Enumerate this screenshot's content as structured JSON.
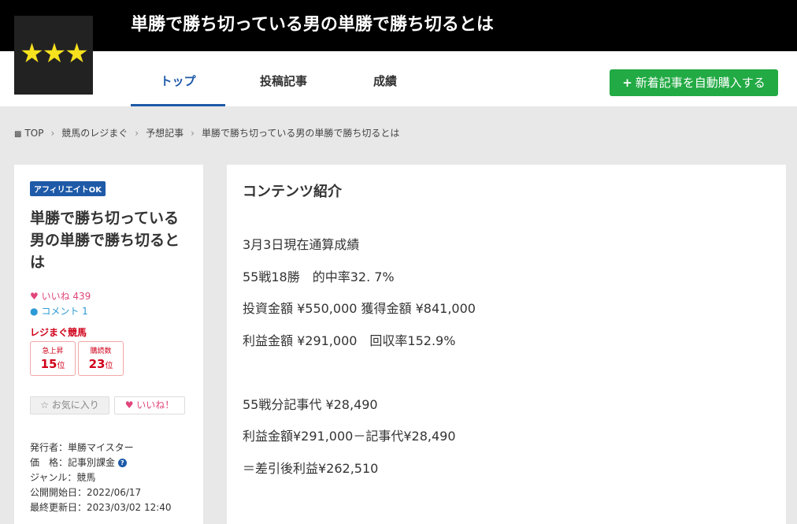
{
  "header": {
    "site_title": "単勝で勝ち切っている男の単勝で勝ち切るとは",
    "logo_stars": "★★★"
  },
  "nav": {
    "tabs": [
      {
        "label": "トップ",
        "active": true
      },
      {
        "label": "投稿記事",
        "active": false
      },
      {
        "label": "成績",
        "active": false
      }
    ],
    "buy_button": "新着記事を自動購入する",
    "buy_icon": "+"
  },
  "breadcrumb": {
    "items": [
      "TOP",
      "競馬のレジまぐ",
      "予想記事",
      "単勝で勝ち切っている男の単勝で勝ち切るとは"
    ],
    "separator": "›"
  },
  "sidebar": {
    "badge": "アフィリエイトOK",
    "title": "単勝で勝ち切っている男の単勝で勝ち切るとは",
    "likes": "いいね 439",
    "comments": "コメント 1",
    "category": "レジまぐ競馬",
    "ranks": [
      {
        "label": "急上昇",
        "value": "15",
        "unit": "位"
      },
      {
        "label": "購読数",
        "value": "23",
        "unit": "位"
      }
    ],
    "favorite_button": "お気に入り",
    "like_button": "いいね！",
    "meta": {
      "publisher": "発行者：単勝マイスター",
      "price": "価　格：記事別課金",
      "genre": "ジャンル：競馬",
      "start_date": "公開開始日：2022/06/17",
      "updated": "最終更新日：2023/03/02 12:40"
    }
  },
  "main": {
    "heading": "コンテンツ紹介",
    "lines": [
      "3月3日現在通算成績",
      "55戦18勝　的中率32. 7%",
      "投資金額 ¥550,000 獲得金額 ¥841,000",
      "利益金額 ¥291,000　回収率152.9%",
      "",
      "55戦分記事代 ¥28,490",
      "利益金額¥291,000－記事代¥28,490",
      "＝差引後利益¥262,510"
    ]
  },
  "colors": {
    "accent": "#1e5aa8",
    "buy_button": "#22aa44",
    "like_pink": "#e0457b",
    "rank_red": "#d0021b"
  }
}
